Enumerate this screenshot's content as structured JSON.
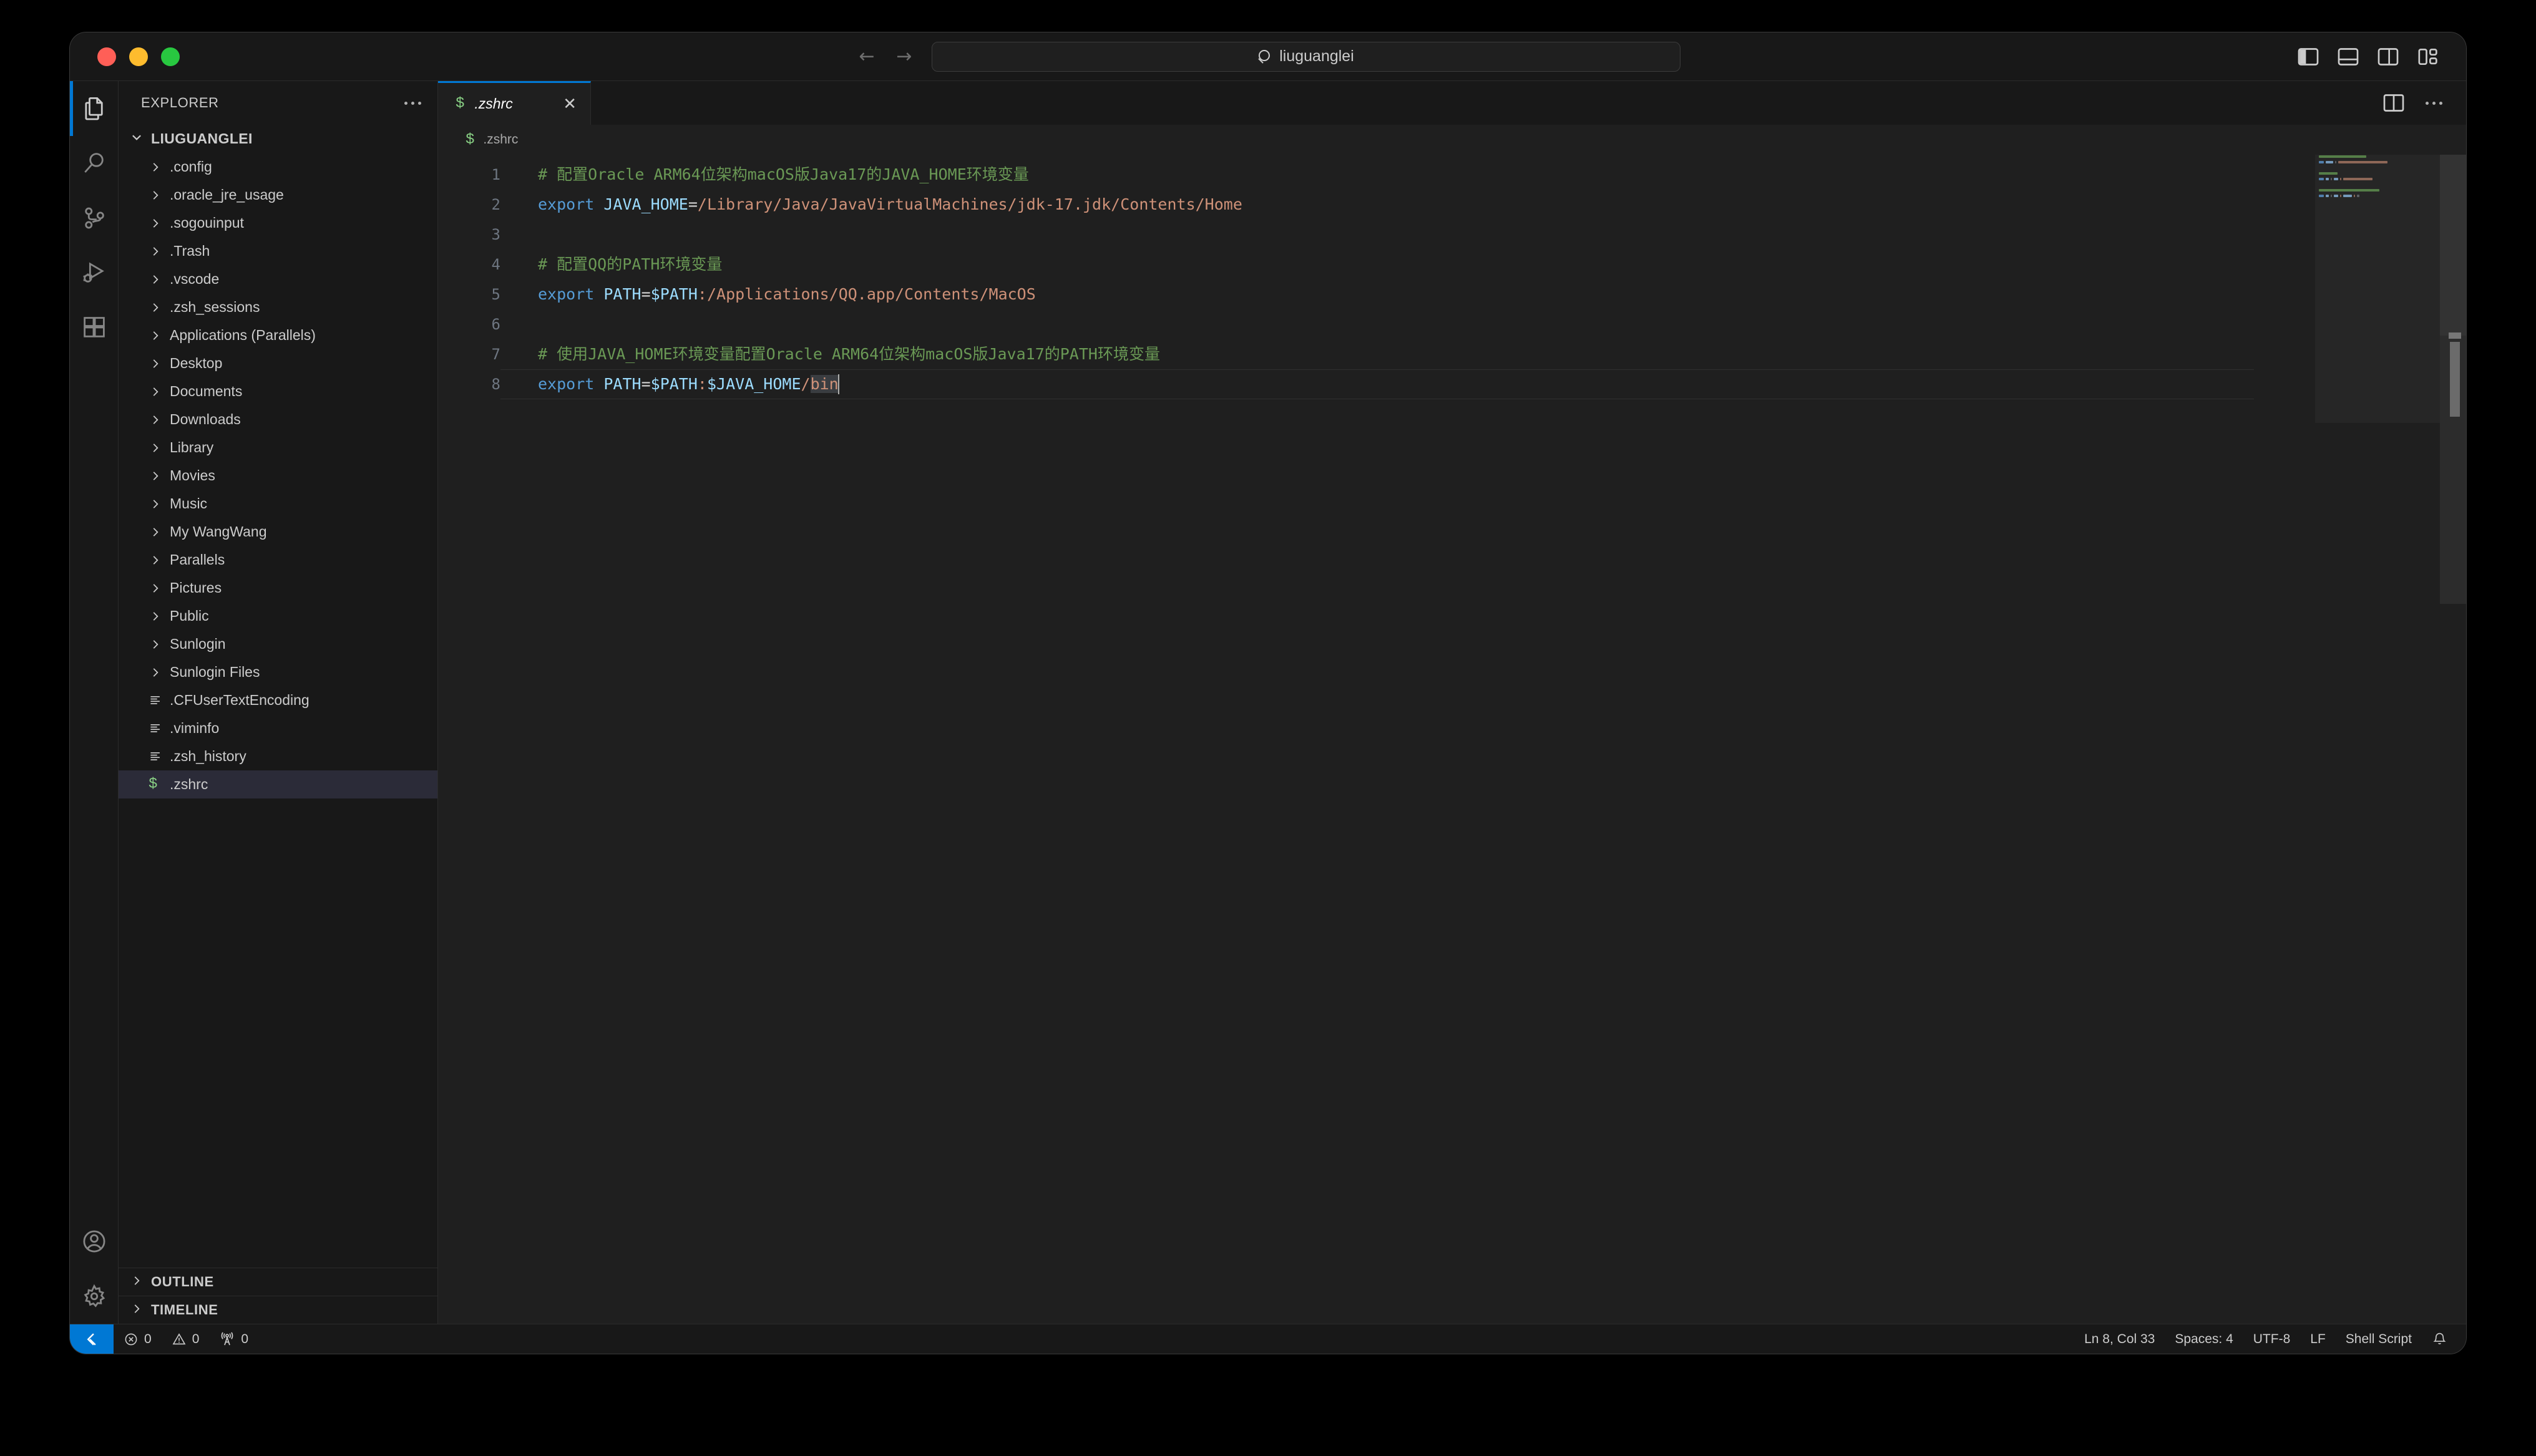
{
  "window": {
    "traffic_lights": [
      "close",
      "minimize",
      "maximize"
    ],
    "colors": {
      "close": "#ff5f57",
      "minimize": "#febc2e",
      "maximize": "#28c840",
      "accent": "#0078d4",
      "editor_bg": "#1f1f1f",
      "chrome_bg": "#181818",
      "selection": "#3a3d41"
    }
  },
  "titlebar": {
    "back_arrow": "←",
    "forward_arrow": "→",
    "command_center_text": "liuguanglei",
    "command_center_icon": "search-icon",
    "layout_icons": [
      "toggle-primary-sidebar-icon",
      "toggle-panel-icon",
      "toggle-secondary-sidebar-icon",
      "customize-layout-icon"
    ]
  },
  "activitybar": {
    "items": [
      {
        "name": "explorer",
        "icon": "files-icon",
        "active": true
      },
      {
        "name": "search",
        "icon": "search-icon",
        "active": false
      },
      {
        "name": "source-control",
        "icon": "source-control-icon",
        "active": false
      },
      {
        "name": "run-and-debug",
        "icon": "run-debug-icon",
        "active": false
      },
      {
        "name": "extensions",
        "icon": "extensions-icon",
        "active": false
      }
    ],
    "bottom_items": [
      {
        "name": "accounts",
        "icon": "account-icon"
      },
      {
        "name": "manage-settings",
        "icon": "gear-icon"
      }
    ]
  },
  "sidebar": {
    "title": "EXPLORER",
    "more_actions_icon": "ellipsis-icon",
    "root": {
      "label": "LIUGUANGLEI",
      "expanded": true,
      "twisty": "chevron-down-icon"
    },
    "files": [
      {
        "label": ".config",
        "type": "folder",
        "icon": "chevron-right-icon"
      },
      {
        "label": ".oracle_jre_usage",
        "type": "folder",
        "icon": "chevron-right-icon"
      },
      {
        "label": ".sogouinput",
        "type": "folder",
        "icon": "chevron-right-icon"
      },
      {
        "label": ".Trash",
        "type": "folder",
        "icon": "chevron-right-icon"
      },
      {
        "label": ".vscode",
        "type": "folder",
        "icon": "chevron-right-icon"
      },
      {
        "label": ".zsh_sessions",
        "type": "folder",
        "icon": "chevron-right-icon"
      },
      {
        "label": "Applications (Parallels)",
        "type": "folder",
        "icon": "chevron-right-icon"
      },
      {
        "label": "Desktop",
        "type": "folder",
        "icon": "chevron-right-icon"
      },
      {
        "label": "Documents",
        "type": "folder",
        "icon": "chevron-right-icon"
      },
      {
        "label": "Downloads",
        "type": "folder",
        "icon": "chevron-right-icon"
      },
      {
        "label": "Library",
        "type": "folder",
        "icon": "chevron-right-icon"
      },
      {
        "label": "Movies",
        "type": "folder",
        "icon": "chevron-right-icon"
      },
      {
        "label": "Music",
        "type": "folder",
        "icon": "chevron-right-icon"
      },
      {
        "label": "My WangWang",
        "type": "folder",
        "icon": "chevron-right-icon"
      },
      {
        "label": "Parallels",
        "type": "folder",
        "icon": "chevron-right-icon"
      },
      {
        "label": "Pictures",
        "type": "folder",
        "icon": "chevron-right-icon"
      },
      {
        "label": "Public",
        "type": "folder",
        "icon": "chevron-right-icon"
      },
      {
        "label": "Sunlogin",
        "type": "folder",
        "icon": "chevron-right-icon"
      },
      {
        "label": "Sunlogin Files",
        "type": "folder",
        "icon": "chevron-right-icon"
      },
      {
        "label": ".CFUserTextEncoding",
        "type": "file",
        "icon": "text-file-icon"
      },
      {
        "label": ".viminfo",
        "type": "file",
        "icon": "text-file-icon"
      },
      {
        "label": ".zsh_history",
        "type": "file",
        "icon": "text-file-icon"
      },
      {
        "label": ".zshrc",
        "type": "file",
        "icon": "shell-script-icon",
        "selected": true
      }
    ],
    "sections": [
      {
        "label": "OUTLINE",
        "expanded": false,
        "twisty": "chevron-right-icon"
      },
      {
        "label": "TIMELINE",
        "expanded": false,
        "twisty": "chevron-right-icon"
      }
    ]
  },
  "editor": {
    "tab": {
      "label": ".zshrc",
      "icon": "shell-script-icon",
      "close_icon": "close-icon",
      "preview": true,
      "active": true
    },
    "tab_actions": [
      "split-editor-icon",
      "more-actions-icon"
    ],
    "breadcrumb": {
      "icon": "shell-script-icon",
      "label": ".zshrc"
    },
    "language": "Shell Script",
    "lines": [
      {
        "number": 1,
        "tokens": [
          {
            "text": "# 配置Oracle ARM64位架构macOS版Java17的JAVA_HOME环境变量",
            "type": "comment"
          }
        ]
      },
      {
        "number": 2,
        "tokens": [
          {
            "text": "export",
            "type": "keyword"
          },
          {
            "text": " ",
            "type": "plain"
          },
          {
            "text": "JAVA_HOME",
            "type": "variable"
          },
          {
            "text": "=",
            "type": "operator"
          },
          {
            "text": "/Library/Java/JavaVirtualMachines/jdk-17.jdk/Contents/Home",
            "type": "string"
          }
        ]
      },
      {
        "number": 3,
        "tokens": []
      },
      {
        "number": 4,
        "tokens": [
          {
            "text": "# 配置QQ的PATH环境变量",
            "type": "comment"
          }
        ]
      },
      {
        "number": 5,
        "tokens": [
          {
            "text": "export",
            "type": "keyword"
          },
          {
            "text": " ",
            "type": "plain"
          },
          {
            "text": "PATH",
            "type": "variable"
          },
          {
            "text": "=",
            "type": "operator"
          },
          {
            "text": "$PATH",
            "type": "variable"
          },
          {
            "text": ":",
            "type": "string"
          },
          {
            "text": "/Applications/QQ.app/Contents/MacOS",
            "type": "string"
          }
        ]
      },
      {
        "number": 6,
        "tokens": []
      },
      {
        "number": 7,
        "tokens": [
          {
            "text": "# 使用JAVA_HOME环境变量配置Oracle ARM64位架构macOS版Java17的PATH环境变量",
            "type": "comment"
          }
        ]
      },
      {
        "number": 8,
        "current": true,
        "tokens": [
          {
            "text": "export",
            "type": "keyword"
          },
          {
            "text": " ",
            "type": "plain"
          },
          {
            "text": "PATH",
            "type": "variable"
          },
          {
            "text": "=",
            "type": "operator"
          },
          {
            "text": "$PATH",
            "type": "variable"
          },
          {
            "text": ":",
            "type": "string"
          },
          {
            "text": "$JAVA_HOME",
            "type": "variable"
          },
          {
            "text": "/",
            "type": "string"
          },
          {
            "text": "bin",
            "type": "string",
            "selected": true
          }
        ]
      }
    ]
  },
  "statusbar": {
    "remote_icon": "remote-window-icon",
    "left": [
      {
        "name": "problems-errors",
        "icon": "error-circle-icon",
        "value": "0"
      },
      {
        "name": "problems-warnings",
        "icon": "warning-triangle-icon",
        "value": "0"
      },
      {
        "name": "ports",
        "icon": "radio-tower-icon",
        "value": "0"
      }
    ],
    "right": [
      {
        "name": "editor-position",
        "label": "Ln 8, Col 33"
      },
      {
        "name": "editor-indentation",
        "label": "Spaces: 4"
      },
      {
        "name": "editor-encoding",
        "label": "UTF-8"
      },
      {
        "name": "editor-eol",
        "label": "LF"
      },
      {
        "name": "editor-language",
        "label": "Shell Script"
      },
      {
        "name": "notifications",
        "icon": "bell-icon",
        "label": ""
      }
    ]
  }
}
